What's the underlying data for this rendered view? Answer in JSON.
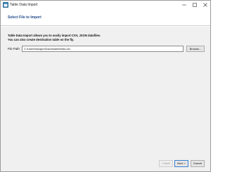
{
  "window": {
    "title": "Table Data Import",
    "app_icon": "dbeaver-app-icon",
    "controls": {
      "minimize": "minimize-icon",
      "maximize": "maximize-icon",
      "close": "close-icon"
    }
  },
  "header": {
    "title": "Select File to Import"
  },
  "main": {
    "description_line1": "Table Data Import allows you to easily import CSV, JSON datafiles.",
    "description_line2": "You can also create destination table on the fly.",
    "file_path_label": "File Path:",
    "file_path_value": "C:\\Users\\lavapn\\Downloads\\fruits.csv",
    "browse_label": "Browse..."
  },
  "footer": {
    "back_label": "< Back",
    "next_label": "Next >",
    "cancel_label": "Cancel"
  },
  "colors": {
    "title_blue": "#1f4a8a",
    "content_bg": "#f0f0f0",
    "focus_border": "#3c7fd1"
  }
}
